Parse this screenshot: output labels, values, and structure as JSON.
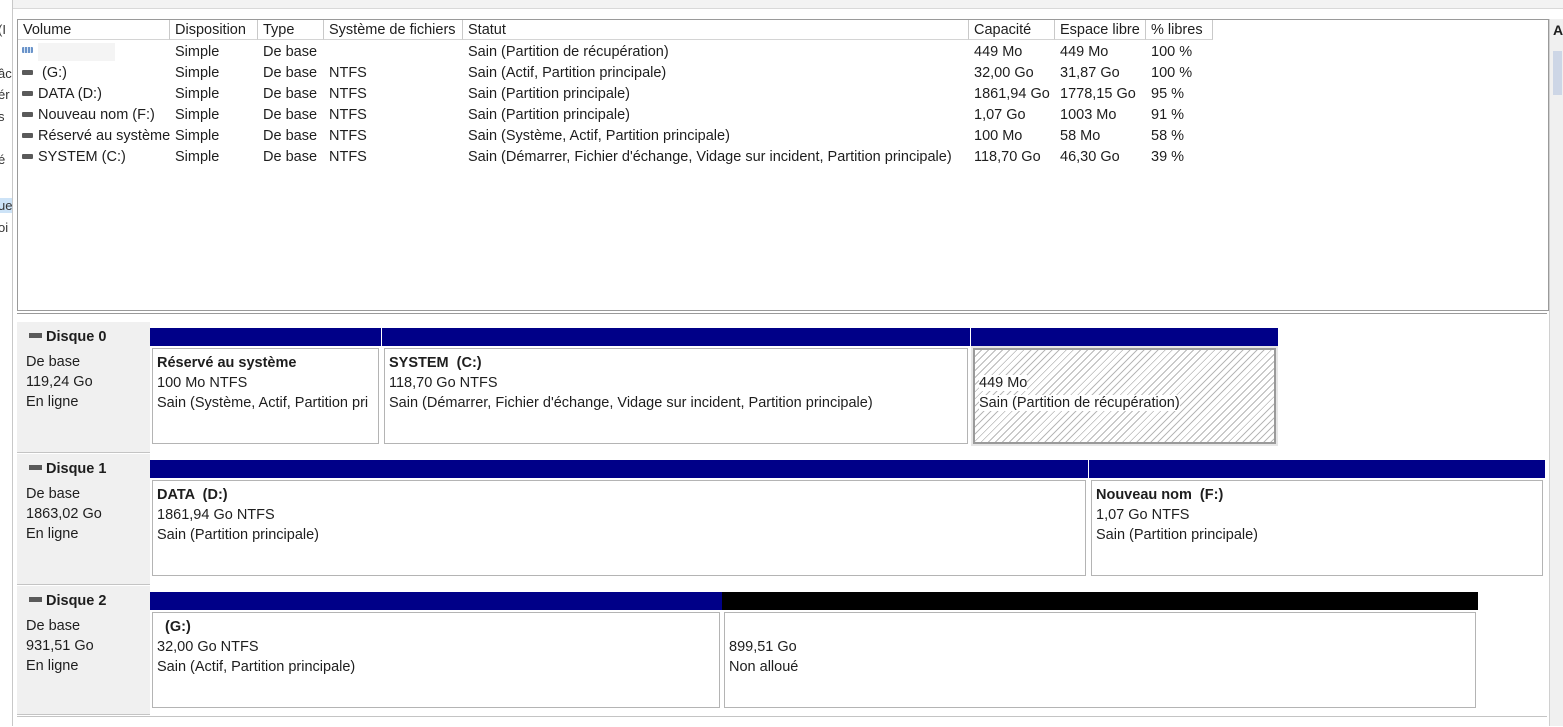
{
  "left_clipped": [
    "(I",
    "âc",
    "ér",
    "s",
    "é",
    "ue",
    "oi"
  ],
  "right_clipped": "A",
  "columns": [
    "Volume",
    "Disposition",
    "Type",
    "Système de fichiers",
    "Statut",
    "Capacité",
    "Espace libre",
    "% libres"
  ],
  "volumes": [
    {
      "icon": "recovery-volume-icon",
      "name": "",
      "layout": "Simple",
      "type": "De base",
      "fs": "",
      "status": "Sain (Partition de récupération)",
      "capacity": "449 Mo",
      "free": "449 Mo",
      "pct": "100 %"
    },
    {
      "icon": "volume-icon",
      "name": " (G:)",
      "layout": "Simple",
      "type": "De base",
      "fs": "NTFS",
      "status": "Sain (Actif, Partition principale)",
      "capacity": "32,00 Go",
      "free": "31,87 Go",
      "pct": "100 %"
    },
    {
      "icon": "volume-icon",
      "name": "DATA (D:)",
      "layout": "Simple",
      "type": "De base",
      "fs": "NTFS",
      "status": "Sain (Partition principale)",
      "capacity": "1861,94 Go",
      "free": "1778,15 Go",
      "pct": "95 %"
    },
    {
      "icon": "volume-icon",
      "name": "Nouveau nom (F:)",
      "layout": "Simple",
      "type": "De base",
      "fs": "NTFS",
      "status": "Sain (Partition principale)",
      "capacity": "1,07 Go",
      "free": "1003 Mo",
      "pct": "91 %"
    },
    {
      "icon": "volume-icon",
      "name": "Réservé au système",
      "layout": "Simple",
      "type": "De base",
      "fs": "NTFS",
      "status": "Sain (Système, Actif, Partition principale)",
      "capacity": "100 Mo",
      "free": "58 Mo",
      "pct": "58 %"
    },
    {
      "icon": "volume-icon",
      "name": "SYSTEM (C:)",
      "layout": "Simple",
      "type": "De base",
      "fs": "NTFS",
      "status": "Sain (Démarrer, Fichier d'échange, Vidage sur incident, Partition principale)",
      "capacity": "118,70 Go",
      "free": "46,30 Go",
      "pct": "39 %"
    }
  ],
  "disks": [
    {
      "name": "Disque 0",
      "type": "De base",
      "size": "119,24 Go",
      "state": "En ligne",
      "partitions": [
        {
          "title": "Réservé au système",
          "size": "100 Mo NTFS",
          "status": "Sain (Système, Actif, Partition pri"
        },
        {
          "title": "SYSTEM  (C:)",
          "size": "118,70 Go NTFS",
          "status": "Sain (Démarrer, Fichier d'échange, Vidage sur incident, Partition principale)"
        },
        {
          "title": "",
          "size": "449 Mo",
          "status": "Sain (Partition de récupération)"
        }
      ]
    },
    {
      "name": "Disque 1",
      "type": "De base",
      "size": "1863,02 Go",
      "state": "En ligne",
      "partitions": [
        {
          "title": "DATA  (D:)",
          "size": "1861,94 Go NTFS",
          "status": "Sain (Partition principale)"
        },
        {
          "title": "Nouveau nom  (F:)",
          "size": "1,07 Go NTFS",
          "status": "Sain (Partition principale)"
        }
      ]
    },
    {
      "name": "Disque 2",
      "type": "De base",
      "size": "931,51 Go",
      "state": "En ligne",
      "partitions": [
        {
          "title": "  (G:)",
          "size": "32,00 Go NTFS",
          "status": "Sain (Actif, Partition principale)"
        },
        {
          "title": "",
          "size": "899,51 Go",
          "status": "Non alloué"
        }
      ]
    }
  ],
  "colors": {
    "primary_partition": "#000088",
    "unallocated": "#000000"
  }
}
